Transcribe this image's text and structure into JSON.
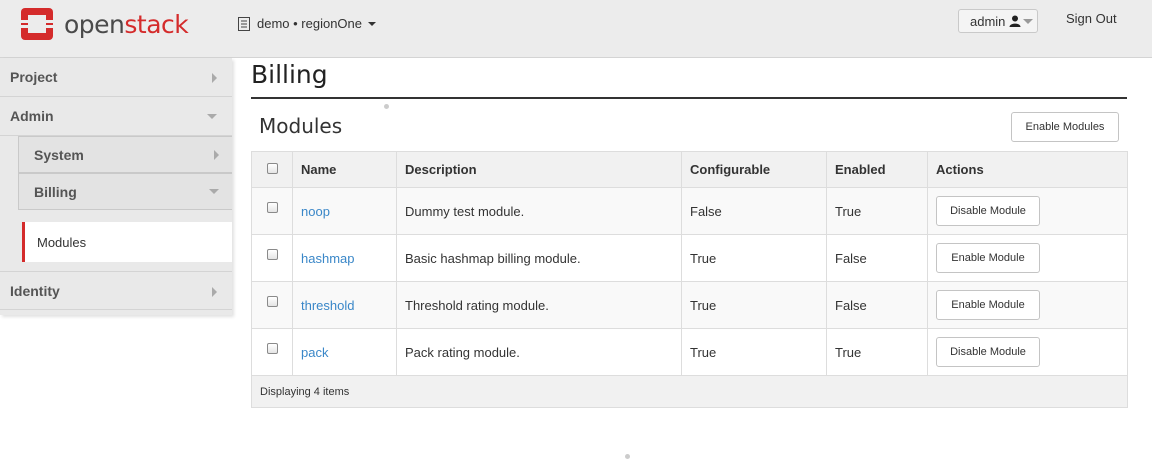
{
  "brand": {
    "open": "open",
    "stack": "stack"
  },
  "navbar": {
    "project_switch": "demo • regionOne",
    "user": "admin",
    "sign_out": "Sign Out"
  },
  "sidebar": {
    "project": "Project",
    "admin": "Admin",
    "system": "System",
    "billing": "Billing",
    "modules": "Modules",
    "identity": "Identity"
  },
  "page": {
    "title": "Billing",
    "section_title": "Modules",
    "enable_modules_label": "Enable Modules"
  },
  "table": {
    "headers": {
      "name": "Name",
      "description": "Description",
      "configurable": "Configurable",
      "enabled": "Enabled",
      "actions": "Actions"
    },
    "rows": [
      {
        "name": "noop",
        "description": "Dummy test module.",
        "configurable": "False",
        "enabled": "True",
        "action": "Disable Module"
      },
      {
        "name": "hashmap",
        "description": "Basic hashmap billing module.",
        "configurable": "True",
        "enabled": "False",
        "action": "Enable Module"
      },
      {
        "name": "threshold",
        "description": "Threshold rating module.",
        "configurable": "True",
        "enabled": "False",
        "action": "Enable Module"
      },
      {
        "name": "pack",
        "description": "Pack rating module.",
        "configurable": "True",
        "enabled": "True",
        "action": "Disable Module"
      }
    ],
    "footer": "Displaying 4 items"
  },
  "colors": {
    "accent_red": "#d42b2b",
    "link_blue": "#3a87c8",
    "navbar_bg": "#ececec",
    "sidebar_bg": "#e9e9e9"
  },
  "icons": {
    "logo": "openstack-logo-icon",
    "project": "document-icon",
    "user": "user-icon"
  }
}
